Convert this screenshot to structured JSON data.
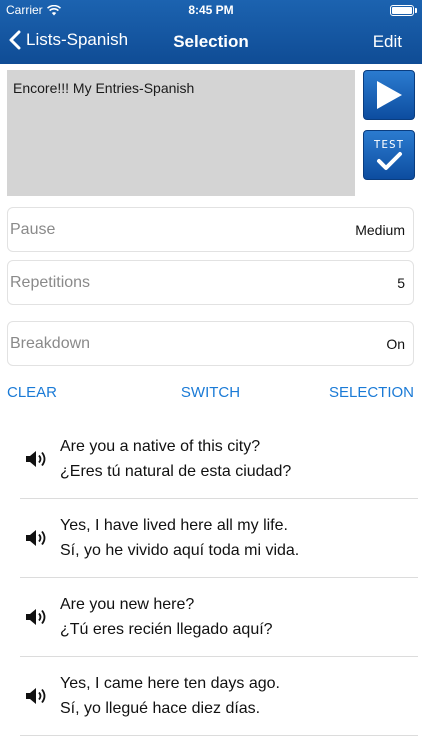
{
  "status_bar": {
    "carrier": "Carrier",
    "time": "8:45 PM"
  },
  "nav": {
    "back_label": "Lists-Spanish",
    "title": "Selection",
    "edit_label": "Edit"
  },
  "list_box": {
    "text": "Encore!!! My Entries-Spanish"
  },
  "buttons": {
    "test_line1": "TEST"
  },
  "settings": [
    {
      "label": "Pause",
      "value": "Medium"
    },
    {
      "label": "Repetitions",
      "value": "5"
    },
    {
      "label": "Breakdown",
      "value": "On"
    }
  ],
  "actions": {
    "clear": "CLEAR",
    "switch": "SWITCH",
    "selection": "SELECTION"
  },
  "phrases": [
    {
      "english": "Are you a native of this city?",
      "spanish": "¿Eres tú natural de esta ciudad?"
    },
    {
      "english": "Yes, I have lived here all my life.",
      "spanish": "Sí, yo he vivido aquí toda mi vida."
    },
    {
      "english": "Are you new here?",
      "spanish": "¿Tú eres recién llegado aquí?"
    },
    {
      "english": "Yes, I came here ten days ago.",
      "spanish": "Sí, yo llegué hace diez días."
    }
  ],
  "colors": {
    "nav": "#125499",
    "accent": "#1a7ad6",
    "list_box": "#d4d4d4"
  },
  "icons": {
    "back": "chevron-left-icon",
    "play": "play-icon",
    "test": "test-check-icon",
    "speaker": "speaker-icon"
  }
}
